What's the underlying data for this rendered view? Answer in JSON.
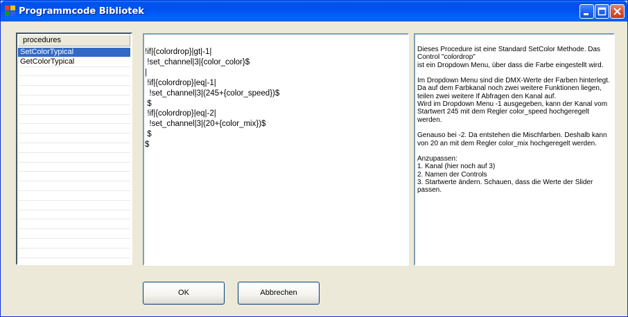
{
  "window": {
    "title": "Programmcode Bibliotek"
  },
  "procedures": {
    "header": "procedures",
    "items": [
      {
        "label": "SetColorTypical",
        "selected": true
      },
      {
        "label": "GetColorTypical",
        "selected": false
      }
    ]
  },
  "code": {
    "text": "!if|{colordrop}|gt|-1|\n !set_channel|3|{color_color}$\n|\n !if|{colordrop}|eq|-1|\n  !set_channel|3|(245+{color_speed})$\n $\n !if|{colordrop}|eq|-2|\n  !set_channel|3|(20+{color_mix})$\n $\n$"
  },
  "description": {
    "text": "Dieses Procedure ist eine Standard SetColor Methode. Das Control \"colordrop\"\nist ein Dropdown Menu, über dass die Farbe eingestellt wird.\n\nIm Dropdown Menu sind die DMX-Werte der Farben hinterlegt.\nDa auf dem Farbkanal noch zwei weitere Funktionen liegen, teilen zwei weitere If Abfragen den Kanal auf.\nWird im Dropdown Menu -1 ausgegeben, kann der Kanal vom Startwert 245 mit dem Regler color_speed hochgeregelt werden.\n\nGenauso bei -2. Da entstehen die Mischfarben. Deshalb kann von 20 an mit dem Regler color_mix hochgeregelt werden.\n\nAnzupassen:\n1. Kanal (hier noch auf 3)\n2. Namen der Controls\n3. Startwerte ändern. Schauen, dass die Werte der Slider passen."
  },
  "buttons": {
    "ok": "OK",
    "cancel": "Abbrechen"
  },
  "colors": {
    "titlebar": "#0053ee",
    "selection": "#316ac5",
    "face": "#ece9d8"
  }
}
